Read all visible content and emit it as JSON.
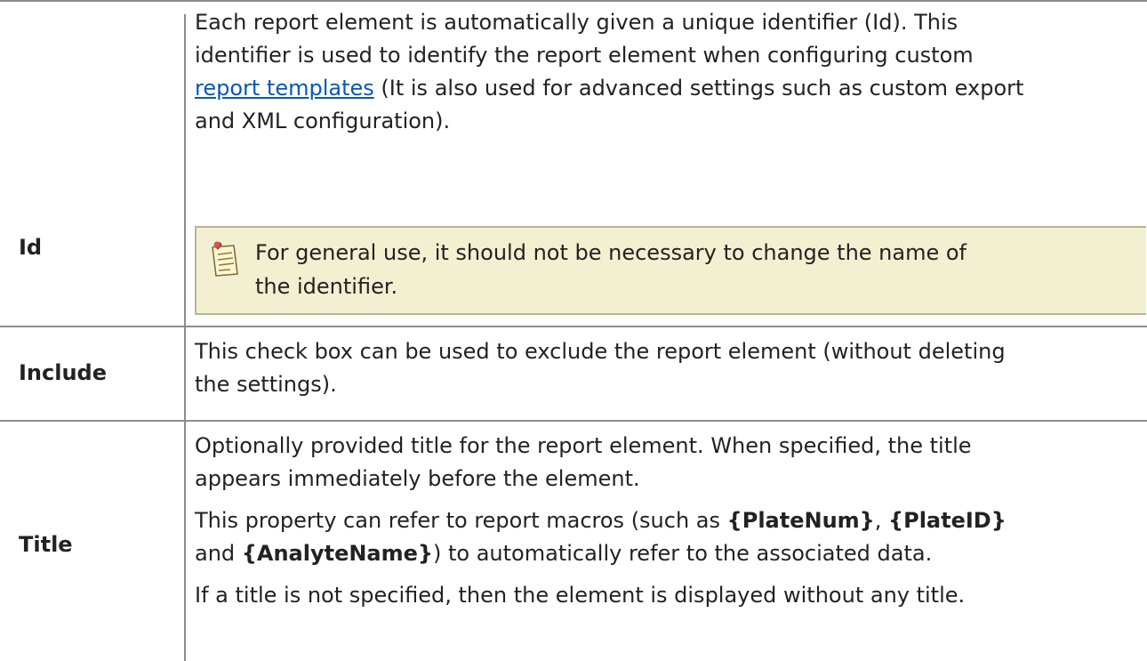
{
  "rows": [
    {
      "label": "Id",
      "p1_before_link": "Each report element is automatically given a unique identifier (Id). This",
      "p1_line2": "identifier is used to identify the report element when configuring custom",
      "link": "report templates",
      "p1_after_link": " (It is also used for advanced settings such as custom export",
      "p1_line4": "and XML configuration).",
      "note_line1": "For general use, it should not be necessary to change the name of",
      "note_line2": "the identifier.",
      "note_icon": "note-icon"
    },
    {
      "label": "Include",
      "line1": "This check box can be used to exclude the report element (without deleting",
      "line2": "the settings)."
    },
    {
      "label": "Title",
      "p1_line1": "Optionally provided title for the report element. When specified, the title",
      "p1_line2": "appears immediately before the element.",
      "p2_text1": "This property can refer to report macros (such as ",
      "p2_macro1": "{PlateNum}",
      "p2_sep1": ", ",
      "p2_macro2": "{PlateID}",
      "p2_text2": "and ",
      "p2_macro3": "{AnalyteName}",
      "p2_text3": ") to automatically refer to the associated data.",
      "p3": "If a title is not specified, then the element is displayed without any title."
    }
  ],
  "colors": {
    "link": "#0b57b3",
    "note_bg": "#f3efd1",
    "border": "#8c8c8c"
  }
}
